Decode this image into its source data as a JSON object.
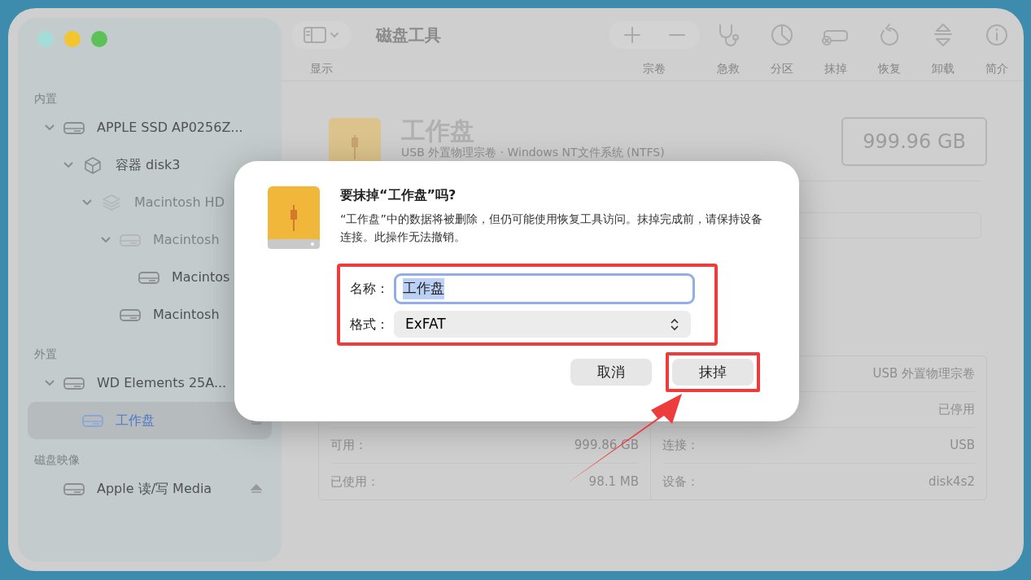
{
  "window": {
    "title": "磁盘工具"
  },
  "toolbar": {
    "view_label": "显示",
    "buttons": [
      {
        "kind": "volume",
        "label": "宗卷"
      },
      {
        "kind": "firstaid",
        "label": "急救"
      },
      {
        "kind": "partition",
        "label": "分区"
      },
      {
        "kind": "erase",
        "label": "抹掉"
      },
      {
        "kind": "restore",
        "label": "恢复"
      },
      {
        "kind": "unmount",
        "label": "卸载"
      },
      {
        "kind": "info",
        "label": "简介"
      }
    ]
  },
  "sidebar": {
    "sections": [
      {
        "title": "内置",
        "items": [
          {
            "label": "APPLE SSD AP0256Z...",
            "kind": "disk",
            "expanded": true,
            "dimmed": false,
            "selected": false,
            "eject": false,
            "children": [
              {
                "label": "容器 disk3",
                "kind": "container",
                "expanded": true,
                "dimmed": false,
                "selected": false,
                "children": [
                  {
                    "label": "Macintosh HD",
                    "kind": "stack",
                    "expanded": true,
                    "dimmed": true,
                    "selected": false,
                    "children": [
                      {
                        "label": "Macintosh",
                        "kind": "disk",
                        "expanded": true,
                        "dimmed": true,
                        "selected": false,
                        "children": [
                          {
                            "label": "Macintos",
                            "kind": "disk",
                            "dimmed": false,
                            "selected": false
                          }
                        ]
                      },
                      {
                        "label": "Macintosh",
                        "kind": "disk",
                        "dimmed": false,
                        "selected": false
                      }
                    ]
                  }
                ]
              }
            ]
          }
        ]
      },
      {
        "title": "外置",
        "items": [
          {
            "label": "WD Elements 25A...",
            "kind": "disk",
            "expanded": true,
            "dimmed": false,
            "selected": false,
            "eject": false,
            "children": [
              {
                "label": "工作盘",
                "kind": "disk",
                "dimmed": false,
                "selected": true,
                "eject": true
              }
            ]
          }
        ]
      },
      {
        "title": "磁盘映像",
        "items": [
          {
            "label": "Apple 读/写 Media",
            "kind": "disk",
            "dimmed": false,
            "selected": false,
            "eject": true
          }
        ]
      }
    ]
  },
  "volume": {
    "name": "工作盘",
    "subtitle": "USB 外置物理宗卷 · Windows NT文件系统 (NTFS)",
    "capacity": "999.96 GB"
  },
  "info": {
    "left": [
      {
        "label": "可用：",
        "value": "999.86 GB"
      },
      {
        "label": "已使用：",
        "value": "98.1 MB"
      }
    ],
    "right": [
      {
        "value": "USB 外置物理宗卷"
      },
      {
        "value": "已停用"
      },
      {
        "label": "连接：",
        "value": "USB"
      },
      {
        "label": "设备：",
        "value": "disk4s2"
      }
    ]
  },
  "dialog": {
    "title": "要抹掉“工作盘”吗?",
    "message": "“工作盘”中的数据将被删除，但仍可能使用恢复工具访问。抹掉完成前，请保持设备连接。此操作无法撤销。",
    "name_label": "名称：",
    "name_value": "工作盘",
    "name_focused": true,
    "format_label": "格式：",
    "format_value": "ExFAT",
    "buttons": [
      {
        "label": "取消",
        "highlighted": false
      },
      {
        "label": "抹掉",
        "highlighted": true
      }
    ]
  }
}
